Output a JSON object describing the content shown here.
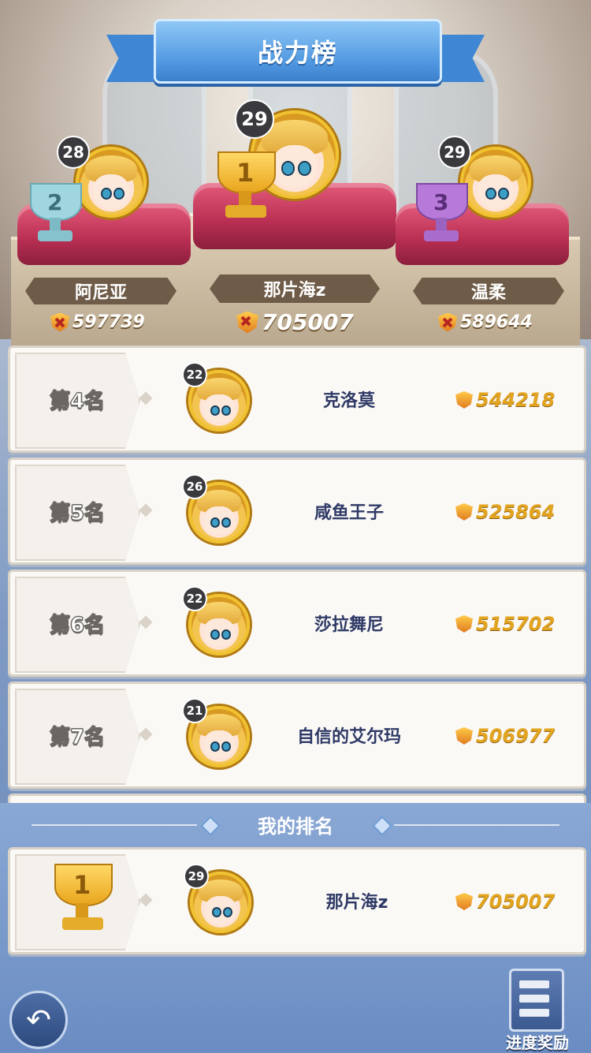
{
  "header": {
    "title": "战力榜"
  },
  "podium": [
    {
      "rank": 2,
      "level": "28",
      "name": "阿尼亚",
      "power": "597739",
      "trophy_color": "#9fd6e0"
    },
    {
      "rank": 1,
      "level": "29",
      "name": "那片海z",
      "power": "705007",
      "trophy_color": "#f2b526"
    },
    {
      "rank": 3,
      "level": "29",
      "name": "温柔",
      "power": "589644",
      "trophy_color": "#b77ad8"
    }
  ],
  "trophy_numbers": [
    "2",
    "1",
    "3"
  ],
  "list": [
    {
      "rank_label": "第4名",
      "level": "22",
      "name": "克洛莫",
      "power": "544218"
    },
    {
      "rank_label": "第5名",
      "level": "26",
      "name": "咸鱼王子",
      "power": "525864"
    },
    {
      "rank_label": "第6名",
      "level": "22",
      "name": "莎拉舞尼",
      "power": "515702"
    },
    {
      "rank_label": "第7名",
      "level": "21",
      "name": "自信的艾尔玛",
      "power": "506977"
    }
  ],
  "my_rank": {
    "section_title": "我的排名",
    "trophy_number": "1",
    "level": "29",
    "name": "那片海z",
    "power": "705007"
  },
  "footer": {
    "reward_label": "进度奖励",
    "back_icon": "back-arrow-icon"
  },
  "colors": {
    "accent_blue": "#4f97e0",
    "gold": "#e3a51f",
    "cushion": "#b72e52"
  }
}
